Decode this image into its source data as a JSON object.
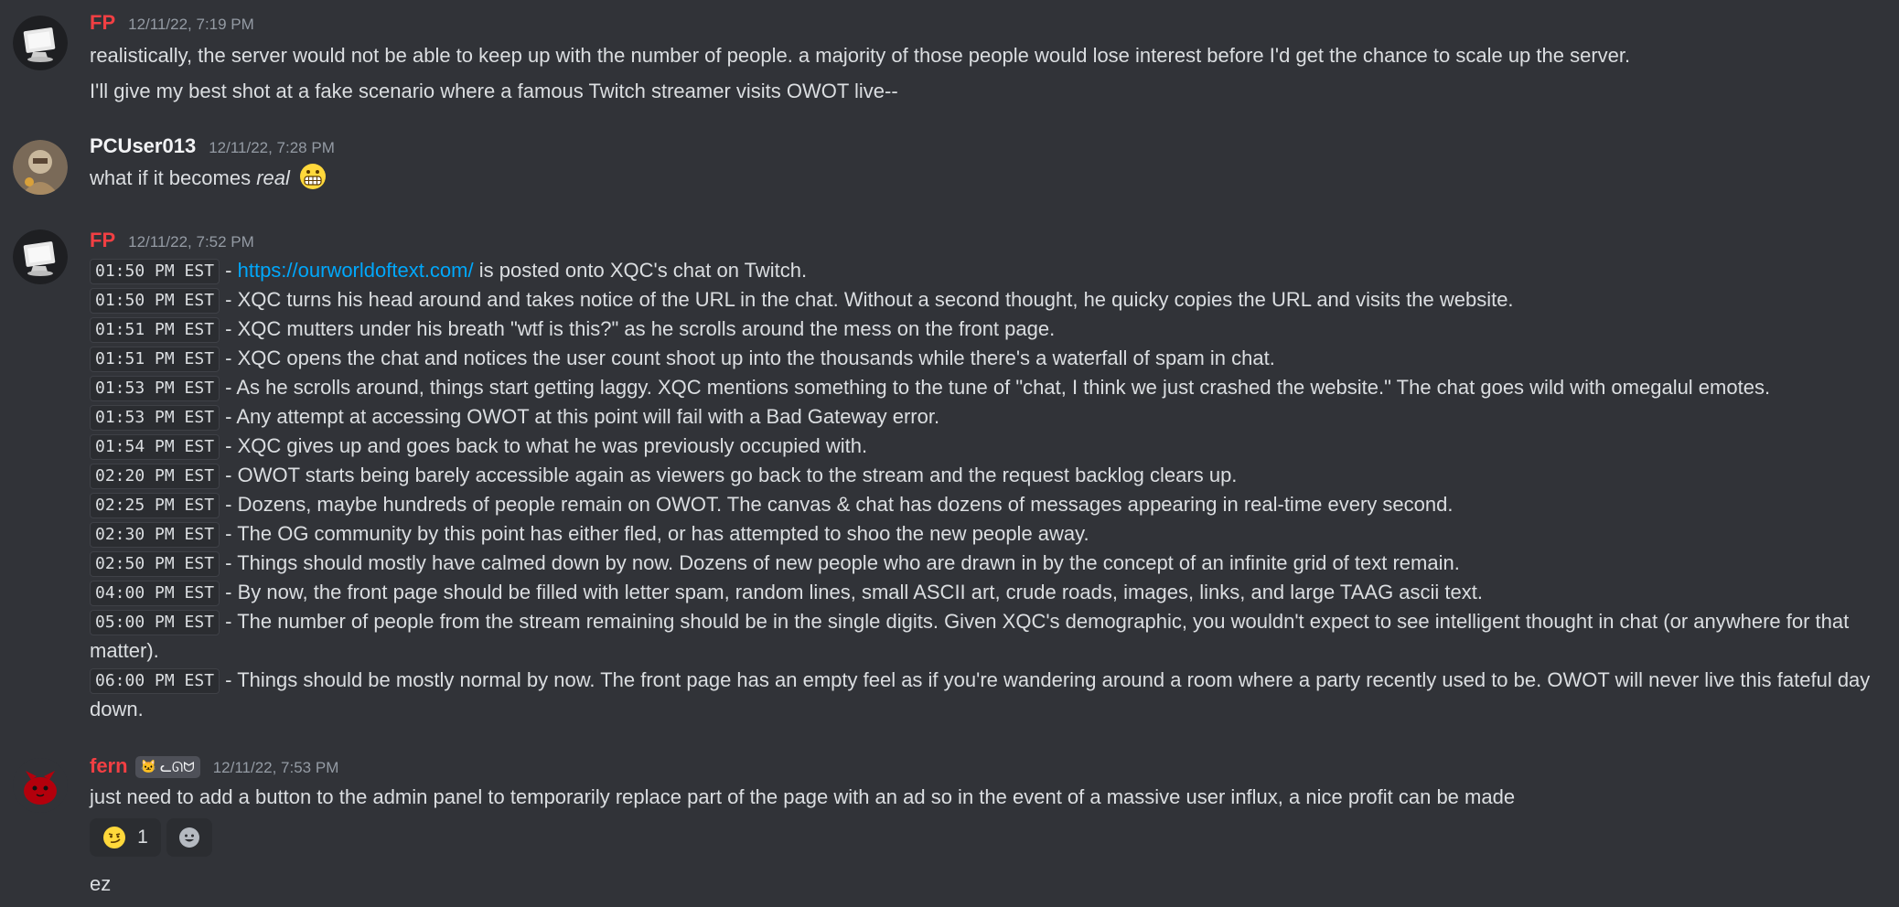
{
  "messages": [
    {
      "author": "FP",
      "timestamp": "12/11/22, 7:19 PM",
      "lines": [
        "realistically, the server would not be able to keep up with the number of people. a majority of those people would lose interest before I'd get the chance to scale up the server.",
        "I'll give my best shot at a fake scenario where a famous Twitch streamer visits OWOT live--"
      ]
    },
    {
      "author": "PCUser013",
      "timestamp": "12/11/22, 7:28 PM",
      "text_before": "what if it becomes ",
      "text_italic": "real",
      "emoji": "grimacing-emoji"
    },
    {
      "author": "FP",
      "timestamp": "12/11/22, 7:52 PM",
      "first_line": {
        "time": "01:50 PM EST",
        "sep": " - ",
        "link": "https://ourworldoftext.com/",
        "rest": " is posted onto XQC's chat on Twitch."
      },
      "events": [
        {
          "time": "01:50 PM EST",
          "text": " - XQC turns his head around and takes notice of the URL in the chat. Without a second thought, he quicky copies the URL and visits the website."
        },
        {
          "time": "01:51 PM EST",
          "text": " - XQC mutters under his breath \"wtf is this?\" as he scrolls around the mess on the front page."
        },
        {
          "time": "01:51 PM EST",
          "text": " - XQC opens the chat and notices the user count shoot up into the thousands while there's a waterfall of spam in chat."
        },
        {
          "time": "01:53 PM EST",
          "text": " - As he scrolls around, things start getting laggy. XQC mentions something to the tune of \"chat, I think we just crashed the website.\" The chat goes wild with omegalul emotes."
        },
        {
          "time": "01:53 PM EST",
          "text": " - Any attempt at accessing OWOT at this point will fail with a Bad Gateway error."
        },
        {
          "time": "01:54 PM EST",
          "text": " - XQC gives up and goes back to what he was previously occupied with."
        },
        {
          "time": "02:20 PM EST",
          "text": " - OWOT starts being barely accessible again as viewers go back to the stream and the request backlog clears up."
        },
        {
          "time": "02:25 PM EST",
          "text": " - Dozens, maybe hundreds of people remain on OWOT. The canvas & chat has dozens of messages appearing in real-time every second."
        },
        {
          "time": "02:30 PM EST",
          "text": " - The OG community by this point has either fled, or has attempted to shoo the new people away."
        },
        {
          "time": "02:50 PM EST",
          "text": " - Things should mostly have calmed down by now. Dozens of new people who are drawn in by the concept of an infinite grid of text remain."
        },
        {
          "time": "04:00 PM EST",
          "text": " - By now, the front page should be filled with letter spam, random lines, small ASCII art, crude roads, images, links, and large TAAG ascii text."
        },
        {
          "time": "05:00 PM EST",
          "text": " - The number of people from the stream remaining should be in the single digits. Given XQC's demographic, you wouldn't expect to see intelligent thought in chat (or anywhere for that matter)."
        },
        {
          "time": "06:00 PM EST",
          "text": " - Things should be mostly normal by now. The front page has an empty feel as if you're wandering around a room where a party recently used to be. OWOT will never live this fateful day down."
        }
      ]
    },
    {
      "author": "fern",
      "tag_text": "ᓚᘏᗢ",
      "tag_icon": "cat-icon",
      "timestamp": "12/11/22, 7:53 PM",
      "text": "just need to add a button to the admin panel to temporarily replace part of the page with an ad so in the event of a massive user influx, a nice profit can be made",
      "reaction": {
        "emoji": "smirk-emoji",
        "count": "1"
      },
      "add_reaction_icon": "add-reaction-icon",
      "followup": "ez"
    }
  ]
}
